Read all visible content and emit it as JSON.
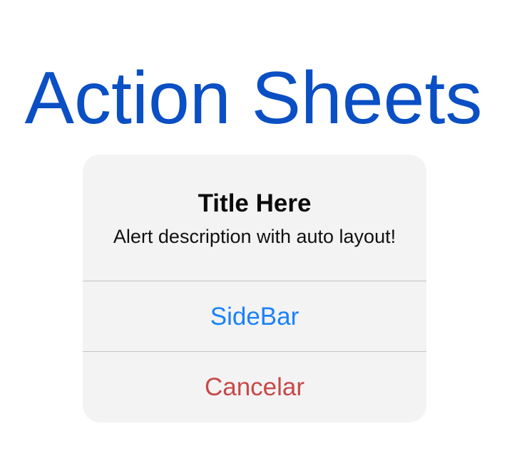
{
  "page": {
    "title": "Action Sheets"
  },
  "action_sheet": {
    "title": "Title Here",
    "message": "Alert description with auto layout!",
    "actions": [
      {
        "label": "SideBar",
        "style": "default",
        "color": "#1a82f7"
      },
      {
        "label": "Cancelar",
        "style": "cancel",
        "color": "#c84848"
      }
    ]
  },
  "colors": {
    "page_title": "#0a4fc4",
    "sheet_background": "#f3f3f3",
    "divider": "#c3c3c3"
  }
}
